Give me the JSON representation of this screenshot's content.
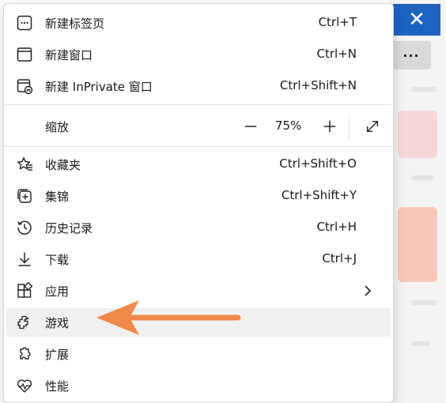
{
  "browser_chrome": {
    "close_glyph": "✕",
    "more_glyph": "···"
  },
  "menu": {
    "items_top": [
      {
        "label": "新建标签页",
        "shortcut": "Ctrl+T",
        "icon": "new-tab-icon"
      },
      {
        "label": "新建窗口",
        "shortcut": "Ctrl+N",
        "icon": "new-window-icon"
      },
      {
        "label": "新建 InPrivate 窗口",
        "shortcut": "Ctrl+Shift+N",
        "icon": "inprivate-icon"
      }
    ],
    "zoom": {
      "label": "缩放",
      "value": "75%",
      "minus_glyph": "—",
      "plus_glyph": "+"
    },
    "items_bottom": [
      {
        "label": "收藏夹",
        "shortcut": "Ctrl+Shift+O",
        "icon": "favorites-icon"
      },
      {
        "label": "集锦",
        "shortcut": "Ctrl+Shift+Y",
        "icon": "collections-icon"
      },
      {
        "label": "历史记录",
        "shortcut": "Ctrl+H",
        "icon": "history-icon"
      },
      {
        "label": "下载",
        "shortcut": "Ctrl+J",
        "icon": "download-icon"
      },
      {
        "label": "应用",
        "shortcut": "",
        "icon": "apps-icon"
      },
      {
        "label": "游戏",
        "shortcut": "",
        "icon": "games-icon"
      },
      {
        "label": "扩展",
        "shortcut": "",
        "icon": "extensions-icon"
      },
      {
        "label": "性能",
        "shortcut": "",
        "icon": "performance-icon"
      }
    ]
  },
  "colors": {
    "accent_blue": "#1e63c0",
    "arrow_orange": "#f08a4b",
    "highlight": "#f0f0f0"
  }
}
